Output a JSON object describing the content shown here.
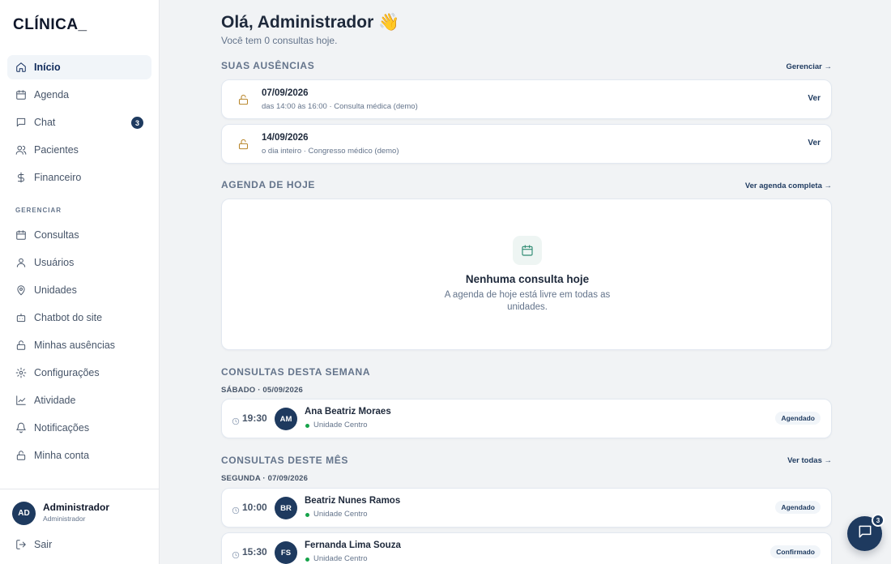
{
  "app": {
    "logo": "CLÍNICA_"
  },
  "sidebar": {
    "items": [
      {
        "label": "Início",
        "icon": "home-icon",
        "active": true
      },
      {
        "label": "Agenda",
        "icon": "calendar-icon"
      },
      {
        "label": "Chat",
        "icon": "chat-icon",
        "badge": "3"
      },
      {
        "label": "Pacientes",
        "icon": "users-icon"
      },
      {
        "label": "Financeiro",
        "icon": "dollar-icon"
      }
    ],
    "section_label": "GERENCIAR",
    "manage_items": [
      {
        "label": "Consultas",
        "icon": "calendar-icon"
      },
      {
        "label": "Usuários",
        "icon": "user-icon"
      },
      {
        "label": "Unidades",
        "icon": "map-pin-icon"
      },
      {
        "label": "Chatbot do site",
        "icon": "bot-icon"
      },
      {
        "label": "Minhas ausências",
        "icon": "lock-icon"
      },
      {
        "label": "Configurações",
        "icon": "gear-icon"
      },
      {
        "label": "Atividade",
        "icon": "activity-icon"
      },
      {
        "label": "Notificações",
        "icon": "bell-icon"
      },
      {
        "label": "Minha conta",
        "icon": "lock-icon"
      }
    ],
    "user": {
      "initials": "AD",
      "name": "Administrador",
      "role": "Administrador"
    },
    "logout_label": "Sair"
  },
  "main": {
    "greeting": "Olá, Administrador 👋",
    "greeting_sub": "Você tem 0 consultas hoje.",
    "absences": {
      "title": "SUAS AUSÊNCIAS",
      "link": "Gerenciar →",
      "items": [
        {
          "date": "07/09/2026",
          "detail": "das 14:00 às 16:00 · Consulta médica (demo)",
          "action": "Ver"
        },
        {
          "date": "14/09/2026",
          "detail": "o dia inteiro · Congresso médico (demo)",
          "action": "Ver"
        }
      ]
    },
    "today": {
      "title": "AGENDA DE HOJE",
      "link": "Ver agenda completa →",
      "empty_title": "Nenhuma consulta hoje",
      "empty_text": "A agenda de hoje está livre em todas as unidades."
    },
    "week": {
      "title": "CONSULTAS DESTA SEMANA",
      "day": "SÁBADO · 05/09/2026",
      "items": [
        {
          "time": "19:30",
          "initials": "AM",
          "name": "Ana Beatriz Moraes",
          "unit": "Unidade Centro",
          "status": "Agendado"
        }
      ]
    },
    "month": {
      "title": "CONSULTAS DESTE MÊS",
      "link": "Ver todas →",
      "day": "SEGUNDA · 07/09/2026",
      "items": [
        {
          "time": "10:00",
          "initials": "BR",
          "name": "Beatriz Nunes Ramos",
          "unit": "Unidade Centro",
          "status": "Agendado"
        },
        {
          "time": "15:30",
          "initials": "FS",
          "name": "Fernanda Lima Souza",
          "unit": "Unidade Centro",
          "status": "Confirmado"
        }
      ]
    }
  },
  "fab": {
    "icon": "chat-icon",
    "badge": "3"
  },
  "colors": {
    "primary": "#1e3a5f",
    "accent_green": "#2e8b72",
    "warning": "#b8862b",
    "background": "#f1f3f5"
  }
}
